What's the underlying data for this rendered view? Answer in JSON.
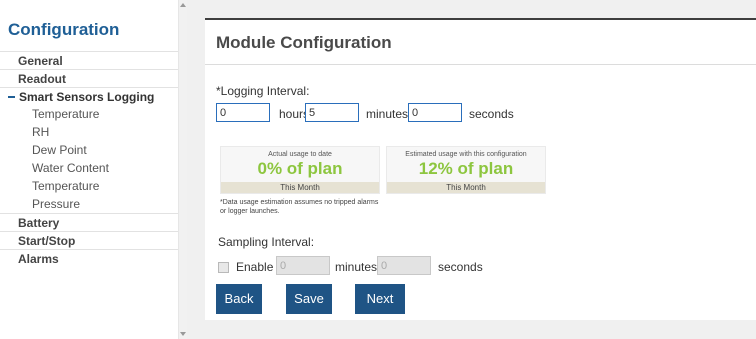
{
  "sidebar": {
    "title": "Configuration",
    "items": [
      {
        "label": "General"
      },
      {
        "label": "Readout"
      },
      {
        "label": "Smart Sensors Logging"
      },
      {
        "label": "Battery"
      },
      {
        "label": "Start/Stop"
      },
      {
        "label": "Alarms"
      }
    ],
    "sub_items": [
      {
        "label": "Temperature"
      },
      {
        "label": "RH"
      },
      {
        "label": "Dew Point"
      },
      {
        "label": "Water Content"
      },
      {
        "label": "Temperature"
      },
      {
        "label": "Pressure"
      }
    ]
  },
  "panel": {
    "title": "Module Configuration",
    "logging": {
      "label": "*Logging Interval:",
      "hours_value": "0",
      "hours_label": "hours",
      "minutes_value": "5",
      "minutes_label": "minutes",
      "seconds_value": "0",
      "seconds_label": "seconds"
    },
    "usage": {
      "actual_caption": "Actual usage to date",
      "actual_value": "0% of plan",
      "actual_period": "This Month",
      "estimated_caption": "Estimated usage with this configuration",
      "estimated_value": "12% of plan",
      "estimated_period": "This Month",
      "value_color": "#8dc63f"
    },
    "note": "*Data usage estimation assumes no tripped alarms or logger launches.",
    "sampling": {
      "label": "Sampling Interval:",
      "enable_label": "Enable",
      "enabled": false,
      "minutes_value": "0",
      "minutes_label": "minutes",
      "seconds_value": "0",
      "seconds_label": "seconds"
    },
    "buttons": {
      "back": "Back",
      "save": "Save",
      "next": "Next"
    }
  },
  "colors": {
    "brand": "#1f5f96",
    "button": "#1f5485"
  }
}
